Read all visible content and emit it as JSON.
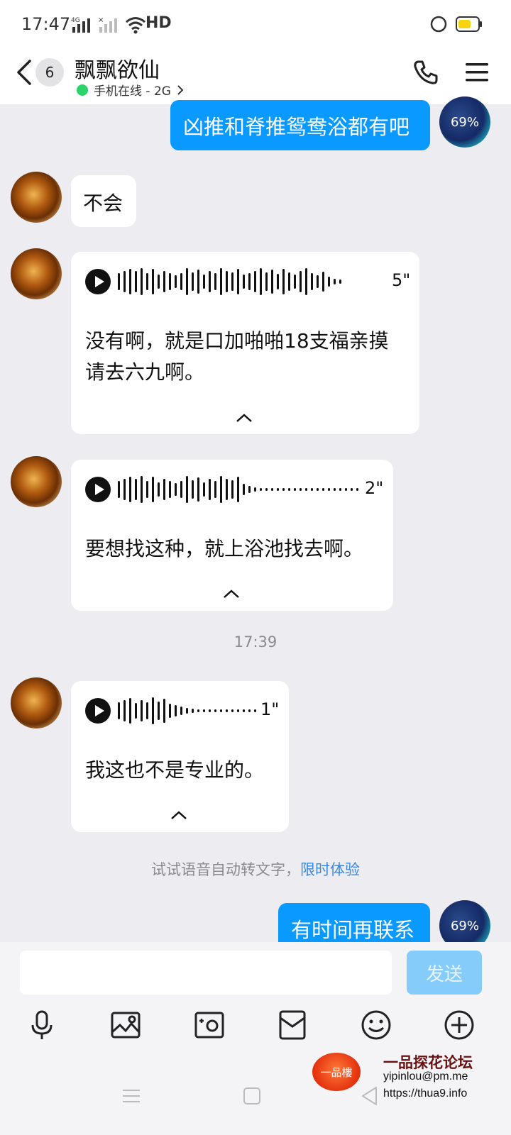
{
  "status_bar": {
    "time": "17:47",
    "network": "4G",
    "hd_label": "HD",
    "battery_color": "#f8d311"
  },
  "header": {
    "back_badge_count": "6",
    "contact_name": "飘飘欲仙",
    "status_text": "手机在线 - 2G",
    "online_color": "#2bd46b"
  },
  "messages": [
    {
      "direction": "out",
      "text": "凶推和脊推鸳鸯浴都有吧",
      "avatar_label": "69%"
    },
    {
      "direction": "in",
      "text": "不会"
    },
    {
      "direction": "in",
      "type": "voice",
      "duration": "5\"",
      "transcript_line1": "没有啊，就是口加啪啪18支福亲摸",
      "transcript_line2": "请去六九啊。"
    },
    {
      "direction": "in",
      "type": "voice",
      "duration": "2\"",
      "transcript_line1": "要想找这种，就上浴池找去啊。"
    },
    {
      "direction": "in",
      "type": "voice",
      "duration": "1\"",
      "transcript_line1": "我这也不是专业的。"
    },
    {
      "direction": "out",
      "text": "有时间再联系",
      "avatar_label": "69%"
    }
  ],
  "timestamp": "17:39",
  "hint": {
    "text": "试试语音自动转文字，",
    "link": "限时体验"
  },
  "input": {
    "value": "",
    "send_label": "发送"
  },
  "toolbar_icons": [
    "microphone-icon",
    "image-icon",
    "camera-icon",
    "red-packet-icon",
    "emoji-icon",
    "plus-icon"
  ],
  "watermark": {
    "logo_text": "一品樓",
    "title": "一品探花论坛",
    "email": "yipinlou@pm.me",
    "url": "https://thua9.info"
  },
  "accent_color": "#0a99ff"
}
